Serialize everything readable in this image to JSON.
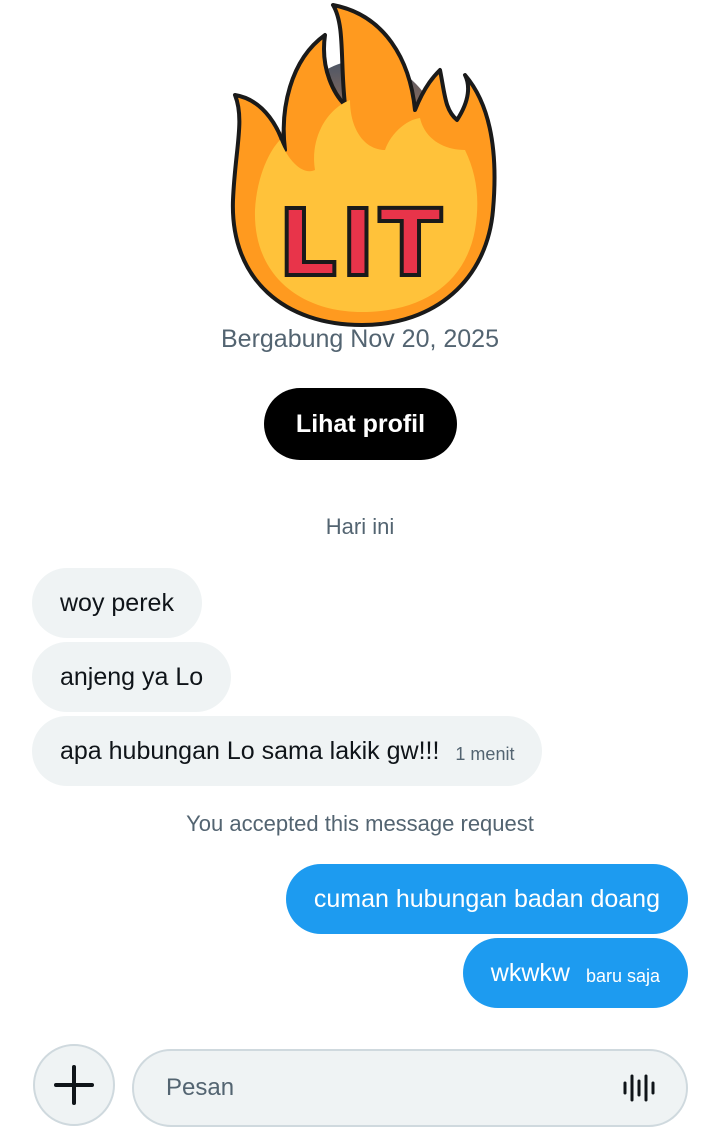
{
  "profile": {
    "joined_text": "Bergabung Nov 20, 2025",
    "view_profile_label": "Lihat profil",
    "sticker_text": "LIT"
  },
  "thread": {
    "day_separator": "Hari ini",
    "incoming": [
      {
        "text": "woy perek",
        "time": ""
      },
      {
        "text": "anjeng ya Lo",
        "time": ""
      },
      {
        "text": "apa hubungan Lo sama lakik gw!!!",
        "time": "1 menit"
      }
    ],
    "system_notice": "You accepted this message request",
    "outgoing": [
      {
        "text": "cuman hubungan badan doang",
        "time": ""
      },
      {
        "text": "wkwkw",
        "time": "baru saja"
      }
    ]
  },
  "composer": {
    "placeholder": "Pesan",
    "value": ""
  },
  "icons": {
    "add": "plus-icon",
    "voice": "voice-waveform-icon"
  },
  "colors": {
    "outgoing_bubble": "#1d9bf0",
    "incoming_bubble": "#eff3f4",
    "secondary_text": "#536471",
    "primary_button": "#000000"
  }
}
